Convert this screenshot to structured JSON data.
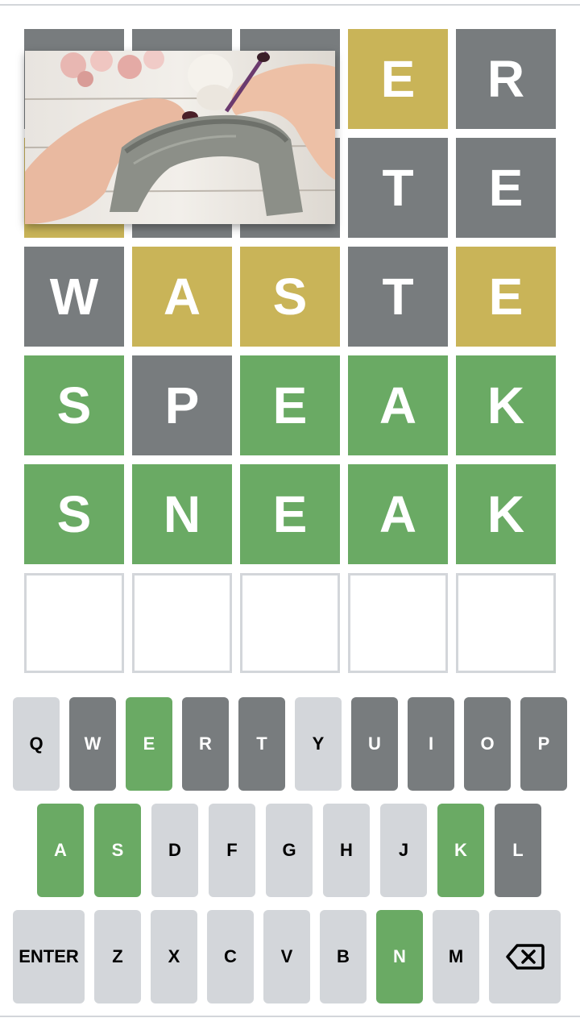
{
  "board": {
    "rows": [
      [
        {
          "letter": "",
          "state": "gray"
        },
        {
          "letter": "",
          "state": "gray"
        },
        {
          "letter": "",
          "state": "gray"
        },
        {
          "letter": "E",
          "state": "yellow"
        },
        {
          "letter": "R",
          "state": "gray"
        }
      ],
      [
        {
          "letter": "",
          "state": "yellow"
        },
        {
          "letter": "",
          "state": "gray"
        },
        {
          "letter": "",
          "state": "gray"
        },
        {
          "letter": "T",
          "state": "gray"
        },
        {
          "letter": "E",
          "state": "gray"
        }
      ],
      [
        {
          "letter": "W",
          "state": "gray"
        },
        {
          "letter": "A",
          "state": "yellow"
        },
        {
          "letter": "S",
          "state": "yellow"
        },
        {
          "letter": "T",
          "state": "gray"
        },
        {
          "letter": "E",
          "state": "yellow"
        }
      ],
      [
        {
          "letter": "S",
          "state": "green"
        },
        {
          "letter": "P",
          "state": "gray"
        },
        {
          "letter": "E",
          "state": "green"
        },
        {
          "letter": "A",
          "state": "green"
        },
        {
          "letter": "K",
          "state": "green"
        }
      ],
      [
        {
          "letter": "S",
          "state": "green"
        },
        {
          "letter": "N",
          "state": "green"
        },
        {
          "letter": "E",
          "state": "green"
        },
        {
          "letter": "A",
          "state": "green"
        },
        {
          "letter": "K",
          "state": "green"
        }
      ],
      [
        {
          "letter": "",
          "state": "empty"
        },
        {
          "letter": "",
          "state": "empty"
        },
        {
          "letter": "",
          "state": "empty"
        },
        {
          "letter": "",
          "state": "empty"
        },
        {
          "letter": "",
          "state": "empty"
        }
      ]
    ]
  },
  "keyboard": {
    "row1": [
      {
        "label": "Q",
        "state": "light"
      },
      {
        "label": "W",
        "state": "gray"
      },
      {
        "label": "E",
        "state": "green"
      },
      {
        "label": "R",
        "state": "gray"
      },
      {
        "label": "T",
        "state": "gray"
      },
      {
        "label": "Y",
        "state": "light"
      },
      {
        "label": "U",
        "state": "gray"
      },
      {
        "label": "I",
        "state": "gray"
      },
      {
        "label": "O",
        "state": "gray"
      },
      {
        "label": "P",
        "state": "gray"
      }
    ],
    "row2": [
      {
        "label": "A",
        "state": "green"
      },
      {
        "label": "S",
        "state": "green"
      },
      {
        "label": "D",
        "state": "light"
      },
      {
        "label": "F",
        "state": "light"
      },
      {
        "label": "G",
        "state": "light"
      },
      {
        "label": "H",
        "state": "light"
      },
      {
        "label": "J",
        "state": "light"
      },
      {
        "label": "K",
        "state": "green"
      },
      {
        "label": "L",
        "state": "gray"
      }
    ],
    "row3": [
      {
        "label": "Z",
        "state": "light"
      },
      {
        "label": "X",
        "state": "light"
      },
      {
        "label": "C",
        "state": "light"
      },
      {
        "label": "V",
        "state": "light"
      },
      {
        "label": "B",
        "state": "light"
      },
      {
        "label": "N",
        "state": "green"
      },
      {
        "label": "M",
        "state": "light"
      }
    ],
    "enter_label": "ENTER",
    "backspace_icon": "backspace-icon"
  },
  "overlay": {
    "icon": "video-thumbnail"
  },
  "colors": {
    "green": "#6aaa64",
    "yellow": "#c9b458",
    "gray": "#787c7e",
    "light": "#d3d6da"
  }
}
